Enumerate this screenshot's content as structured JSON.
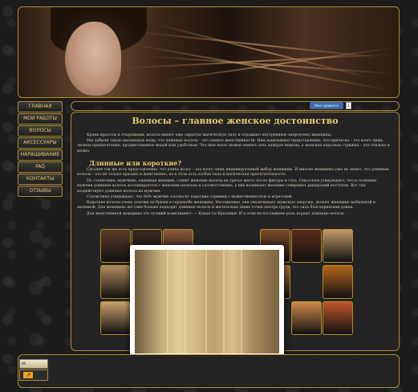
{
  "header": {
    "alt": "Волосы — главное женское достоинство"
  },
  "social": {
    "like_label": "Мне нравится",
    "like_count": "1"
  },
  "menu": [
    {
      "label": "ГЛАВНАЯ"
    },
    {
      "label": "МОИ РАБОТЫ"
    },
    {
      "label": "ВОЛОСЫ"
    },
    {
      "label": "АКСЕССУАРЫ"
    },
    {
      "label": "НАРАЩИВАНИЕ"
    },
    {
      "label": "FAQ"
    },
    {
      "label": "КОНТАКТЫ"
    },
    {
      "label": "ОТЗЫВЫ"
    }
  ],
  "article": {
    "title": "Волосы – главное женское достоинство",
    "p1": "Кроме красоты и очарования, волосы имеют еще скрытую магическую силу и отражают внутреннюю энергетику женщины.",
    "p2": "Мы забыли такую маленькую вещь, что длинные волосы – это символ женственности. Нам навязывают представление, что прическа – это всего лишь личное предпочтение, продиктованное модой или удобством. Что шея волос можно менять хоть каждую неделю, а женская короткая стрижка – это стильно и модно.",
    "subtitle": "Длинные или короткие?",
    "p3": "Сегодня так же есть представление, что длина волос – это всего лишь индивидуальный выбор женщины. И многие женщины уже не знают, что длинные волосы – это не только красиво и женственно, но в этом есть особая сила и магическая притягательность.",
    "p4": "По статистике, мужчины, оценивая женщин, ставят женские волосы на третье место после фигуры и глаз. Сексологи утверждают, что в сознании мужчин длинные волосы ассоциируются с женским началом и соответственно, у них возникает желание совершить рыцарский поступок. Вот так воздействуют длинные волосы на мужчин.",
    "p5": "Статистика утверждает, что 80% мужчин соотносят короткие стрижки с мужественностью и агрессией.",
    "p6": "Короткие волосы очень похожи на брюки в гардеробе женщины. Несомненно, они увеличивают мужскую энергию, делают женщину мобильной и активной. Для женщины же-таки больше подходят длинные волосы и желательно ниже точки центра груди, это сила благоприятная длина.",
    "p7": "Для женственной женщины это лучший комплимент: — Какая ты Красивая! И в этом не последнюю роль играют длинные волосы."
  },
  "gallery": {
    "thumb_count": 12,
    "left_colors": [
      "#5a3b2a",
      "#3a2a22",
      "#8b5a3a",
      "#b08a5a",
      "#2a1f18",
      "#c9a06a"
    ],
    "right_colors": [
      "#7a4a2a",
      "#5a2a1a",
      "#c49a6a",
      "#a06a3a",
      "#b5651d",
      "#c0552a"
    ],
    "lightbox_alt": "Длинные светлые волосы"
  },
  "footer": {
    "badge1_text": "ИЕ",
    "badge2_arrow": "↗"
  }
}
